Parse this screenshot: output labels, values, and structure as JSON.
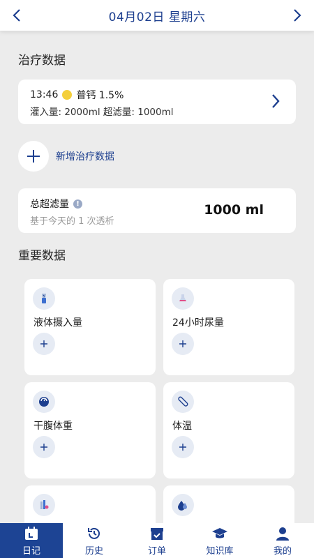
{
  "header": {
    "date_title": "04月02日 星期六"
  },
  "treatment": {
    "section_title": "治疗数据",
    "entry": {
      "time": "13:46",
      "solution": "普钙 1.5%",
      "detail": "灌入量: 2000ml  超滤量: 1000ml"
    },
    "add_label": "新增治疗数据"
  },
  "ultrafiltration": {
    "title": "总超滤量",
    "subtitle": "基于今天的 1 次透析",
    "value": "1000 ml"
  },
  "important": {
    "section_title": "重要数据",
    "tiles": [
      {
        "label": "液体摄入量",
        "icon": "fluid-intake-icon"
      },
      {
        "label": "24小时尿量",
        "icon": "urine-volume-icon"
      },
      {
        "label": "干腹体重",
        "icon": "scale-icon"
      },
      {
        "label": "体温",
        "icon": "thermometer-icon"
      },
      {
        "label": "",
        "icon": "blood-pressure-icon"
      },
      {
        "label": "",
        "icon": "drop-icon"
      }
    ]
  },
  "tabs": [
    {
      "label": "日记",
      "icon": "calendar-icon",
      "active": true
    },
    {
      "label": "历史",
      "icon": "history-icon",
      "active": false
    },
    {
      "label": "订单",
      "icon": "order-icon",
      "active": false
    },
    {
      "label": "知识库",
      "icon": "graduation-cap-icon",
      "active": false
    },
    {
      "label": "我的",
      "icon": "user-icon",
      "active": false
    }
  ],
  "colors": {
    "brand": "#1d3f8f",
    "tab_active_bg": "#1d4494",
    "background": "#ececec",
    "solution_dot": "#f4cf3b"
  }
}
